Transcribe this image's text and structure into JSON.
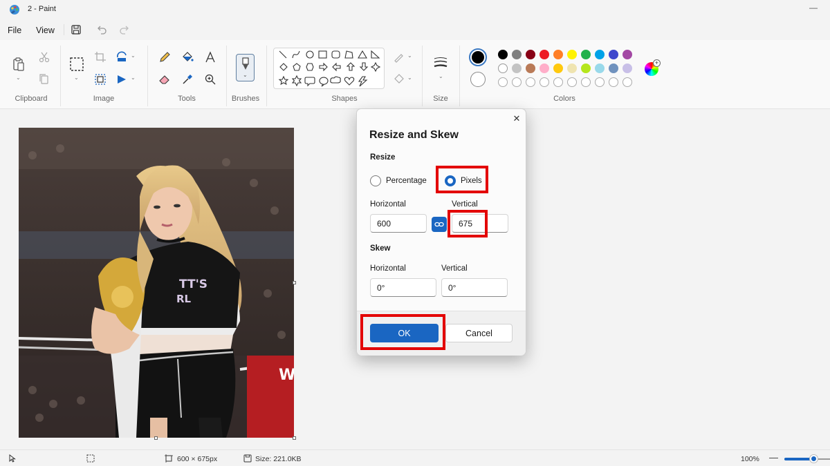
{
  "window": {
    "title": "2 - Paint",
    "minimize_glyph": "—"
  },
  "menu": {
    "file": "File",
    "view": "View"
  },
  "ribbon": {
    "groups": {
      "clipboard": "Clipboard",
      "image": "Image",
      "tools": "Tools",
      "brushes": "Brushes",
      "shapes": "Shapes",
      "size": "Size",
      "colors": "Colors"
    },
    "primary_color": "#000000",
    "secondary_color": "#ffffff",
    "palette_row1": [
      "#000000",
      "#7f7f7f",
      "#880015",
      "#ed1c24",
      "#ff7f27",
      "#fff200",
      "#22b14c",
      "#00a2e8",
      "#3f48cc",
      "#a349a4"
    ],
    "palette_row2": [
      "#ffffff",
      "#c3c3c3",
      "#b97a57",
      "#ffaec9",
      "#ffc90e",
      "#efe4b0",
      "#b5e61d",
      "#99d9ea",
      "#7092be",
      "#c8bfe7"
    ],
    "palette_row3_empty_count": 10
  },
  "dialog": {
    "title": "Resize and Skew",
    "close_glyph": "✕",
    "resize_section": "Resize",
    "percentage_label": "Percentage",
    "pixels_label": "Pixels",
    "selected_mode": "pixels",
    "horizontal_label": "Horizontal",
    "vertical_label": "Vertical",
    "horizontal_value": "600",
    "vertical_value": "675",
    "skew_section": "Skew",
    "skew_horizontal_label": "Horizontal",
    "skew_vertical_label": "Vertical",
    "skew_horizontal_value": "0°",
    "skew_vertical_value": "0°",
    "ok_label": "OK",
    "cancel_label": "Cancel"
  },
  "status": {
    "canvas_size": "600 × 675px",
    "file_size": "Size: 221.0KB",
    "zoom": "100%",
    "zoom_level": 0.63
  },
  "colors": {
    "accent": "#1a66c2",
    "highlight": "#e30000"
  }
}
